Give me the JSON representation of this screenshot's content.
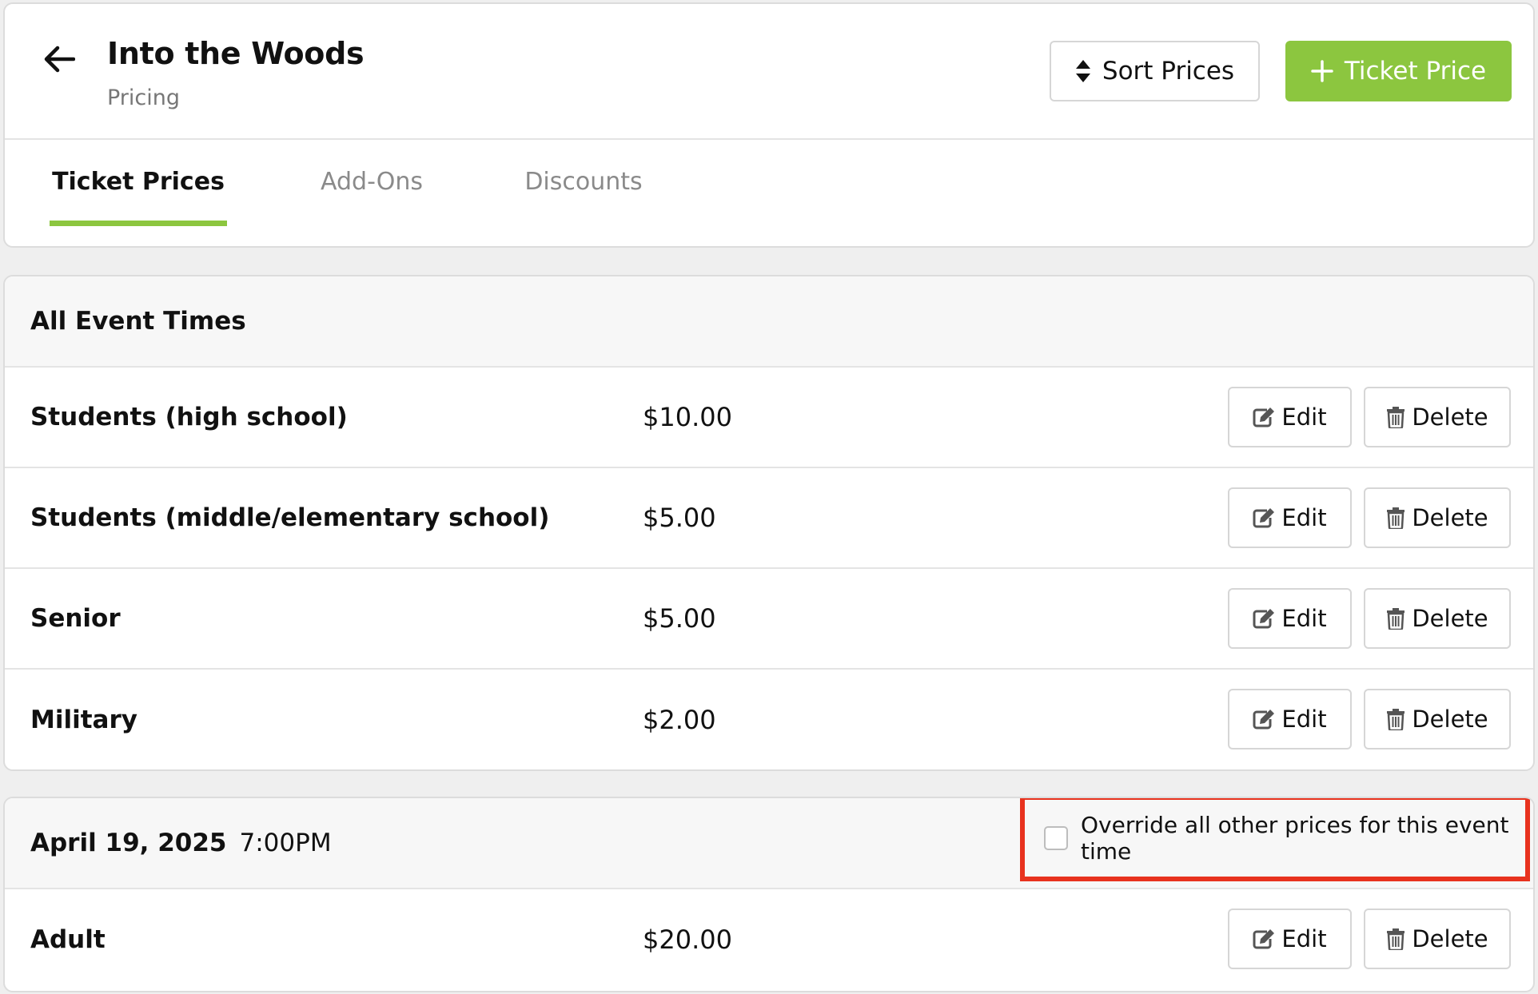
{
  "header": {
    "title": "Into the Woods",
    "subtitle": "Pricing",
    "back_icon": "arrow-left-icon",
    "sort_button": "Sort Prices",
    "add_button": "Ticket Price",
    "accent_color": "#8cc63f"
  },
  "tabs": [
    {
      "label": "Ticket Prices",
      "active": true
    },
    {
      "label": "Add-Ons",
      "active": false
    },
    {
      "label": "Discounts",
      "active": false
    }
  ],
  "sections": [
    {
      "title": "All Event Times",
      "rows": [
        {
          "name": "Students (high school)",
          "price": "$10.00"
        },
        {
          "name": "Students (middle/elementary school)",
          "price": "$5.00"
        },
        {
          "name": "Senior",
          "price": "$5.00"
        },
        {
          "name": "Military",
          "price": "$2.00"
        }
      ]
    },
    {
      "title": "April 19, 2025",
      "time": "7:00PM",
      "override_label": "Override all other prices for this event time",
      "override_checked": false,
      "highlight_color": "#e8321e",
      "rows": [
        {
          "name": "Adult",
          "price": "$20.00"
        }
      ]
    }
  ],
  "actions": {
    "edit": "Edit",
    "delete": "Delete"
  }
}
